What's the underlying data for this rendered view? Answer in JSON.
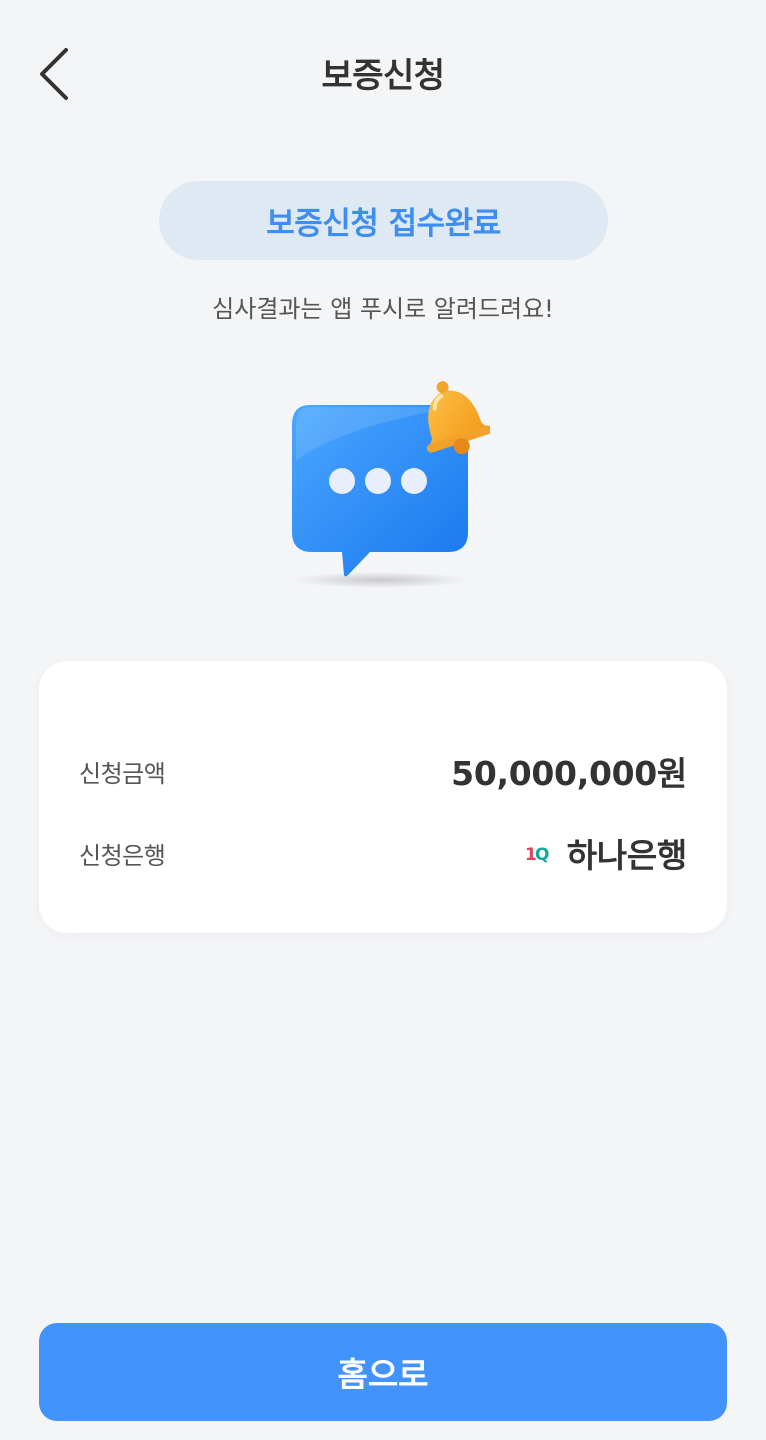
{
  "header": {
    "title": "보증신청",
    "back_icon": "chevron-left-icon"
  },
  "status": {
    "badge_label": "보증신청 접수완료",
    "subtitle": "심사결과는 앱 푸시로 알려드려요!"
  },
  "illustration": {
    "icon": "chat-bubble-bell-icon"
  },
  "info_card": {
    "amount_label": "신청금액",
    "amount_value": "50,000,000원",
    "bank_label": "신청은행",
    "bank_value": "하나은행",
    "bank_logo_text": "1Q"
  },
  "footer": {
    "home_button_label": "홈으로"
  },
  "colors": {
    "background": "#f4f5f7",
    "accent": "#4293fb",
    "badge_bg": "#dfe9f4",
    "badge_text": "#3d8ef0"
  }
}
